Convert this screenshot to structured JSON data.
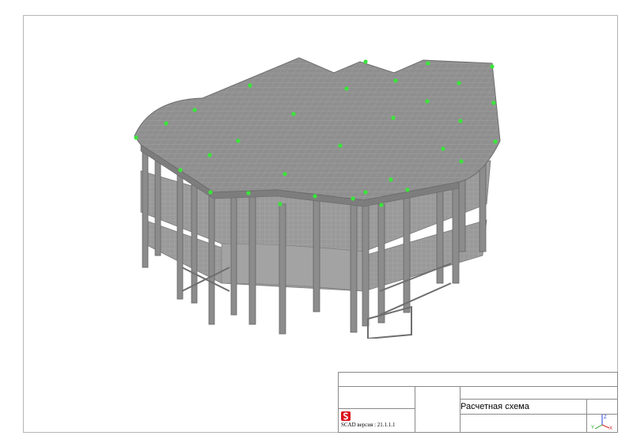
{
  "title_block": {
    "scheme_title": "Расчетная схема",
    "version_label": "SCAD версия : 21.1.1.1",
    "logo_icon": "scad-logo-icon",
    "axes_icon": "coordinate-axes-icon",
    "axis_labels": {
      "z": "Z",
      "x": "X",
      "y": "Y"
    }
  },
  "colors": {
    "structure_fill": "#8f8f8f",
    "structure_dark": "#6e6e6e",
    "support_nodes": "#39e639",
    "logo_red": "#d9141c",
    "frame": "#b5b5b5"
  }
}
